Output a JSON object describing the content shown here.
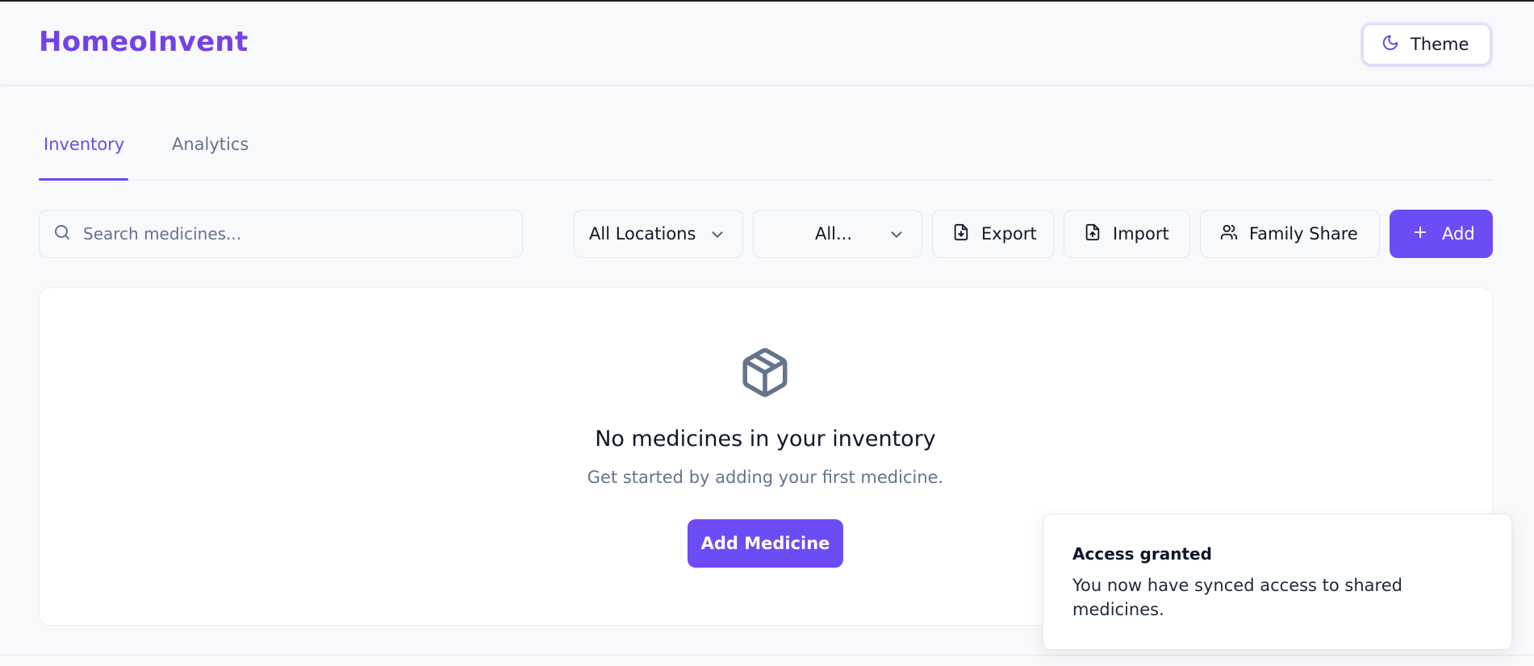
{
  "app": {
    "title": "HomeoInvent"
  },
  "header": {
    "theme_label": "Theme"
  },
  "tabs": [
    {
      "label": "Inventory",
      "active": true
    },
    {
      "label": "Analytics",
      "active": false
    }
  ],
  "toolbar": {
    "search_placeholder": "Search medicines...",
    "location_select": "All Locations",
    "category_select": "All...",
    "export_label": "Export",
    "import_label": "Import",
    "family_share_label": "Family Share",
    "add_label": "Add"
  },
  "empty_state": {
    "title": "No medicines in your inventory",
    "subtitle": "Get started by adding your first medicine.",
    "button_label": "Add Medicine"
  },
  "toast": {
    "title": "Access granted",
    "message": "You now have synced access to shared medicines."
  },
  "icons": {
    "theme": "moon-icon",
    "search": "search-icon",
    "dropdown": "chevron-down-icon",
    "export": "file-download-icon",
    "import": "file-upload-icon",
    "family_share": "users-icon",
    "add": "plus-icon",
    "empty_state": "package-icon"
  },
  "colors": {
    "brand": "#7342e6",
    "primary_button": "#6d4bf5",
    "active_tab": "#6d4be6",
    "muted_text": "#64748b",
    "background": "#f8f9fb"
  }
}
